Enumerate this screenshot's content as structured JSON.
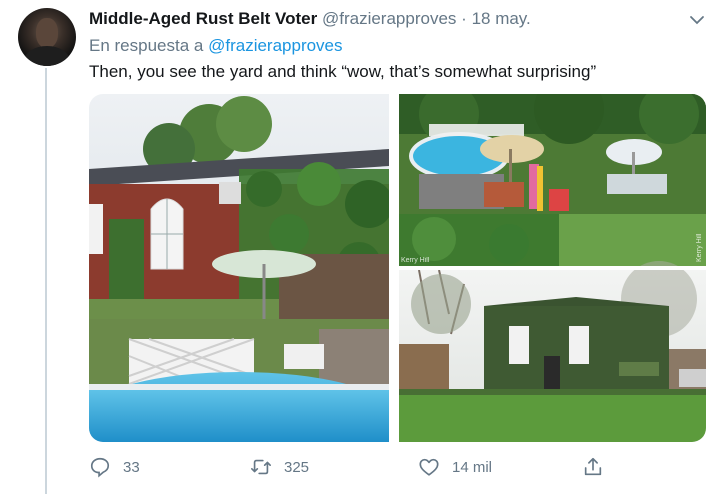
{
  "tweet": {
    "author_name": "Middle-Aged Rust Belt Voter",
    "author_handle": "@frazierapproves",
    "separator": "·",
    "date": "18 may.",
    "reply_prefix": "En respuesta a",
    "reply_to": "@frazierapproves",
    "text": "Then, you see the yard and think “wow, that’s somewhat surprising”"
  },
  "media": {
    "watermark_top_right": "Kerry Hill",
    "watermark_top_left": "Kerry Hill"
  },
  "actions": {
    "replies": "33",
    "retweets": "325",
    "likes": "14 mil"
  },
  "icons": [
    "chevron-down-icon",
    "reply-icon",
    "retweet-icon",
    "like-icon",
    "share-icon"
  ],
  "colors": {
    "link": "#1b95e0",
    "muted": "#657786",
    "text": "#14171a"
  }
}
